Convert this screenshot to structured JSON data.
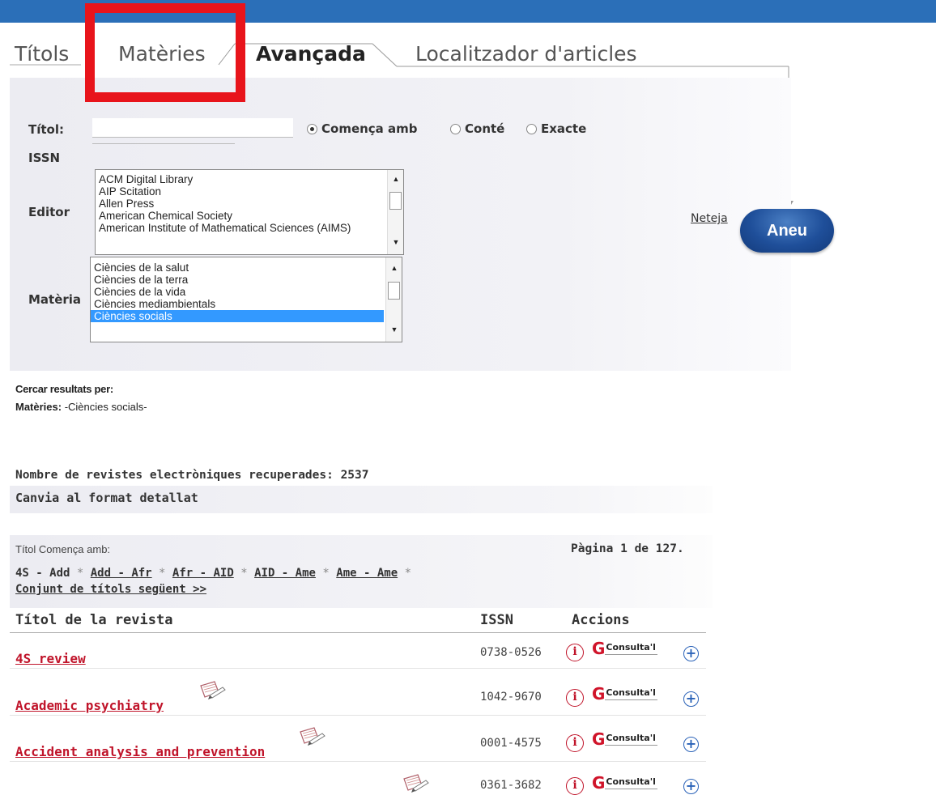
{
  "tabs": [
    {
      "label": "Títols",
      "active": false
    },
    {
      "label": "Matèries",
      "active": false
    },
    {
      "label": "Avançada",
      "active": true
    },
    {
      "label": "Localitzador d'articles",
      "active": false
    }
  ],
  "form": {
    "title_label": "Títol:",
    "title_value": "",
    "radios": [
      {
        "label": "Comença amb",
        "checked": true
      },
      {
        "label": "Conté",
        "checked": false
      },
      {
        "label": "Exacte",
        "checked": false
      }
    ],
    "issn_label": "ISSN",
    "issn_value": "",
    "editor_label": "Editor",
    "editor_options": [
      "ACM Digital Library",
      "AIP Scitation",
      "Allen Press",
      "American Chemical Society",
      "American Institute of Mathematical Sciences (AIMS)"
    ],
    "materia_label": "Matèria",
    "materia_options": [
      {
        "label": "Ciències de la salut",
        "selected": false
      },
      {
        "label": "Ciències de la terra",
        "selected": false
      },
      {
        "label": "Ciències de la vida",
        "selected": false
      },
      {
        "label": "Ciències mediambientals",
        "selected": false
      },
      {
        "label": "Ciències socials",
        "selected": true
      }
    ],
    "clear_label": "Neteja",
    "submit_label": "Aneu"
  },
  "search_summary": {
    "heading": "Cercar resultats per:",
    "subjects_label": "Matèries:",
    "subjects_value": " -Ciències socials-"
  },
  "results": {
    "count_text": "Nombre de revistes electròniques recuperades: 2537",
    "format_toggle": "Canvia al format detallat",
    "filter_text": "Títol Comença amb:",
    "page_text": "Pàgina 1 de 127.",
    "ranges": [
      "4S - Add",
      "Add - Afr",
      "Afr - AID",
      "AID - Ame",
      "Ame - Ame"
    ],
    "next_set": "Conjunt de títols següent >>",
    "columns": {
      "title": "Títol de la revista",
      "issn": "ISSN",
      "actions": "Accions"
    },
    "consult_label": "Consulta'l",
    "info_glyph": "i",
    "rows": [
      {
        "title": "4S review",
        "issn": "0738-0526",
        "has_pencil_icon": false
      },
      {
        "title": "Academic psychiatry",
        "issn": "1042-9670",
        "has_pencil_icon": true
      },
      {
        "title": "Accident analysis and prevention",
        "issn": "0001-4575",
        "has_pencil_icon": true
      },
      {
        "title": "",
        "issn": "0361-3682",
        "has_pencil_icon": true
      }
    ]
  },
  "colors": {
    "top_bar": "#2b6fb8",
    "link_red": "#c0142a",
    "highlight_box": "#e8141b",
    "button_blue": "#1f4f9a",
    "selection": "#3399ff"
  }
}
